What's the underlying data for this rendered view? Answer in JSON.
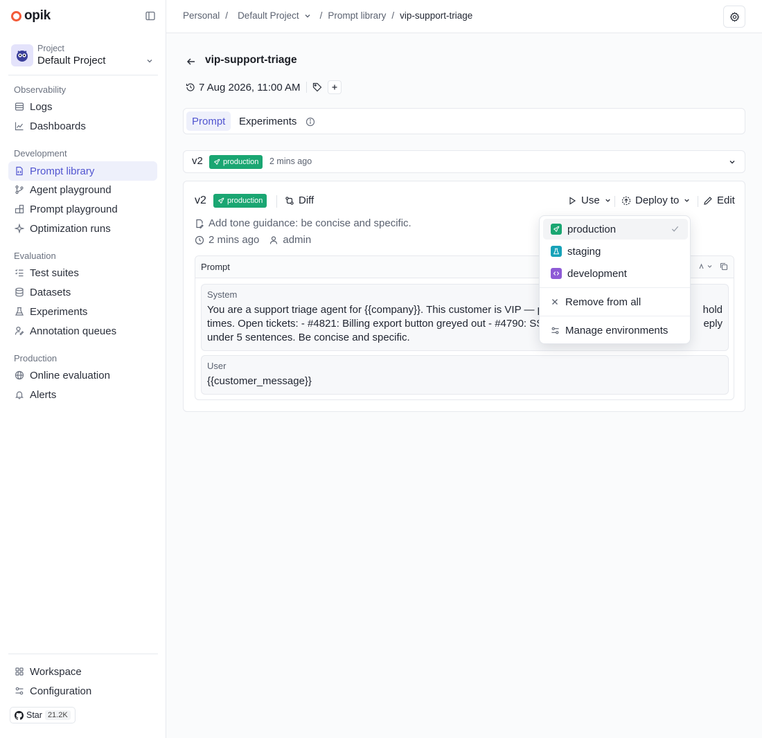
{
  "brand": {
    "name": "opik"
  },
  "project": {
    "label": "Project",
    "name": "Default Project"
  },
  "sidebar": {
    "sections": [
      {
        "title": "Observability",
        "items": [
          {
            "label": "Logs"
          },
          {
            "label": "Dashboards"
          }
        ]
      },
      {
        "title": "Development",
        "items": [
          {
            "label": "Prompt library",
            "active": true
          },
          {
            "label": "Agent playground"
          },
          {
            "label": "Prompt playground"
          },
          {
            "label": "Optimization runs"
          }
        ]
      },
      {
        "title": "Evaluation",
        "items": [
          {
            "label": "Test suites"
          },
          {
            "label": "Datasets"
          },
          {
            "label": "Experiments"
          },
          {
            "label": "Annotation queues"
          }
        ]
      },
      {
        "title": "Production",
        "items": [
          {
            "label": "Online evaluation"
          },
          {
            "label": "Alerts"
          }
        ]
      }
    ],
    "bottom": [
      {
        "label": "Workspace"
      },
      {
        "label": "Configuration"
      }
    ],
    "github": {
      "label": "Star",
      "count": "21.2K"
    }
  },
  "breadcrumbs": {
    "workspace": "Personal",
    "project": "Default Project",
    "section": "Prompt library",
    "current": "vip-support-triage"
  },
  "page": {
    "title": "vip-support-triage",
    "date": "7 Aug 2026, 11:00 AM",
    "tabs": [
      {
        "label": "Prompt"
      },
      {
        "label": "Experiments"
      }
    ]
  },
  "version_bar": {
    "version": "v2",
    "badge": "production",
    "time": "2 mins ago"
  },
  "version_card": {
    "version": "v2",
    "badge": "production",
    "diff_label": "Diff",
    "use_label": "Use",
    "deploy_label": "Deploy to",
    "edit_label": "Edit",
    "commit_message": "Add tone guidance: be concise and specific.",
    "time": "2 mins ago",
    "author": "admin",
    "prompt_header": "Prompt",
    "messages": [
      {
        "role": "System",
        "lines": [
          "You are a support triage agent for {{company}}. This customer is VIP — p",
          "times. Open tickets: - #4821: Billing export button greyed out - #4790: SS",
          "under 5 sentences. Be concise and specific."
        ],
        "tail": [
          "hold",
          "eply",
          ""
        ]
      },
      {
        "role": "User",
        "lines": [
          "{{customer_message}}"
        ],
        "tail": [
          ""
        ]
      }
    ]
  },
  "dropdown": {
    "environments": [
      {
        "label": "production",
        "color": "#1aa672",
        "checked": true
      },
      {
        "label": "staging",
        "color": "#17a2b8"
      },
      {
        "label": "development",
        "color": "#8e5bd6"
      }
    ],
    "remove_label": "Remove from all",
    "manage_label": "Manage environments"
  },
  "colors": {
    "accent": "#5155d0",
    "production": "#1aa672",
    "brand": "#f35b39"
  }
}
